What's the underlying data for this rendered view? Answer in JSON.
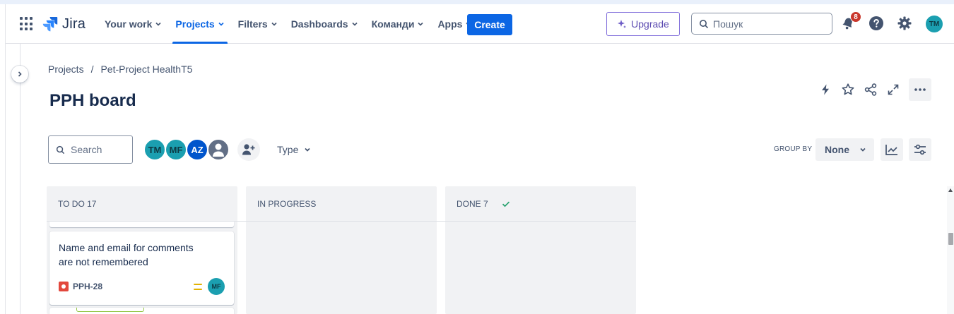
{
  "topnav": {
    "logo_text": "Jira",
    "items": [
      {
        "label": "Your work",
        "active": false
      },
      {
        "label": "Projects",
        "active": true
      },
      {
        "label": "Filters",
        "active": false
      },
      {
        "label": "Dashboards",
        "active": false
      },
      {
        "label": "Команди",
        "active": false
      },
      {
        "label": "Apps",
        "active": false
      }
    ],
    "create_label": "Create",
    "upgrade_label": "Upgrade",
    "search_placeholder": "Пошук",
    "notifications_count": "8",
    "user_initials": "TM"
  },
  "breadcrumb": {
    "items": [
      "Projects",
      "Pet-Project HealthT5"
    ],
    "separator": "/"
  },
  "page": {
    "title": "PPH board"
  },
  "toolbar": {
    "search_placeholder": "Search",
    "assignees": [
      {
        "initials": "TM",
        "color": "#1b9fb0"
      },
      {
        "initials": "MF",
        "color": "#1b9fb0"
      },
      {
        "initials": "AZ",
        "color": "#0055cc"
      }
    ],
    "type_label": "Type",
    "group_by_label": "GROUP BY",
    "group_by_value": "None"
  },
  "columns": [
    {
      "name": "TO DO",
      "count": "17"
    },
    {
      "name": "IN PROGRESS",
      "count": ""
    },
    {
      "name": "DONE",
      "count": "7"
    }
  ],
  "cards": [
    {
      "summary": "Name and email for comments are not remembered",
      "key": "PPH-28",
      "type_icon": "bug-icon",
      "priority_icon": "medium-priority-icon",
      "assignee": "MF"
    }
  ],
  "colors": {
    "brand_blue": "#0c66e4",
    "upgrade_purple": "#5e4db2",
    "bug_red": "#e2483d",
    "priority_medium": "#e2b203",
    "done_check": "#22a06b",
    "notification_badge": "#c9372c"
  }
}
